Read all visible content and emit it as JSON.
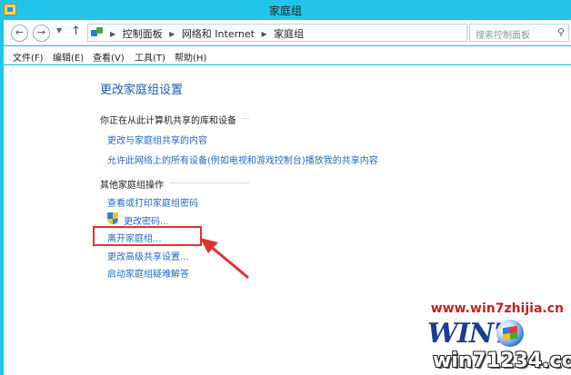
{
  "window": {
    "title": "家庭组"
  },
  "address_bar": {
    "crumbs": [
      "控制面板",
      "网络和 Internet",
      "家庭组"
    ]
  },
  "search": {
    "placeholder": "搜索控制面板"
  },
  "menu": {
    "items": [
      "文件(F)",
      "编辑(E)",
      "查看(V)",
      "工具(T)",
      "帮助(H)"
    ]
  },
  "content": {
    "title": "更改家庭组设置",
    "section1": {
      "heading": "你正在从此计算机共享的库和设备",
      "links": [
        "更改与家庭组共享的内容",
        "允许此网络上的所有设备(例如电视和游戏控制台)播放我的共享内容"
      ]
    },
    "section2": {
      "heading": "其他家庭组操作",
      "links": [
        "查看或打印家庭组密码",
        "更改密码...",
        "离开家庭组...",
        "更改高级共享设置...",
        "启动家庭组疑难解答"
      ]
    }
  },
  "watermark": {
    "url": "www.win7zhijia.cn",
    "logo_text": "WIN7",
    "domain": "win71234.com"
  },
  "icons": {
    "back": "back-arrow-icon",
    "forward": "forward-arrow-icon",
    "up": "up-arrow-icon",
    "refresh": "refresh-icon",
    "search": "search-icon",
    "uac": "uac-shield-icon"
  },
  "colors": {
    "window_frame": "#22c5e8",
    "link": "#1f68c4",
    "title": "#1d5fa8",
    "highlight": "#e0332c"
  }
}
